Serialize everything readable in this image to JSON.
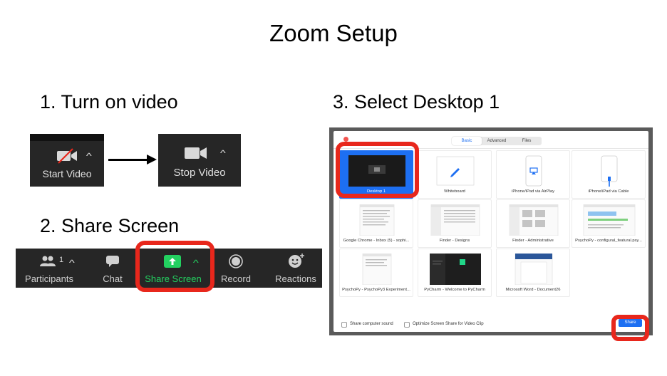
{
  "title": "Zoom Setup",
  "steps": {
    "step1": "1. Turn on video",
    "step2": "2. Share Screen",
    "step3": "3. Select Desktop 1"
  },
  "video": {
    "start_label": "Start Video",
    "stop_label": "Stop Video",
    "icon_before": "video-camera-off-icon",
    "icon_after": "video-camera-icon"
  },
  "toolbar": {
    "participants_label": "Participants",
    "participants_count": "1",
    "chat_label": "Chat",
    "share_label": "Share Screen",
    "record_label": "Record",
    "reactions_label": "Reactions"
  },
  "dialog": {
    "tabs": [
      "Basic",
      "Advanced",
      "Files"
    ],
    "active_tab": "Basic",
    "options": [
      "Desktop 1",
      "Whiteboard",
      "iPhone/iPad via AirPlay",
      "iPhone/iPad via Cable",
      "Google Chrome - Inbox (5) - sophi...",
      "Finder - Designs",
      "Finder - Administrative",
      "PsychoPy - configural_featural.psy...",
      "PsychoPy - PsychoPy3 Experiment...",
      "PyCharm - Welcome to PyCharm",
      "Microsoft Word - Document26"
    ],
    "selected_option": "Desktop 1",
    "share_sound_label": "Share computer sound",
    "optimize_label": "Optimize Screen Share for Video Clip",
    "share_button": "Share"
  },
  "colors": {
    "highlight": "#e8271c",
    "accent_blue": "#1d6ff2",
    "share_green": "#23d160",
    "toolbar_bg": "#262626"
  }
}
